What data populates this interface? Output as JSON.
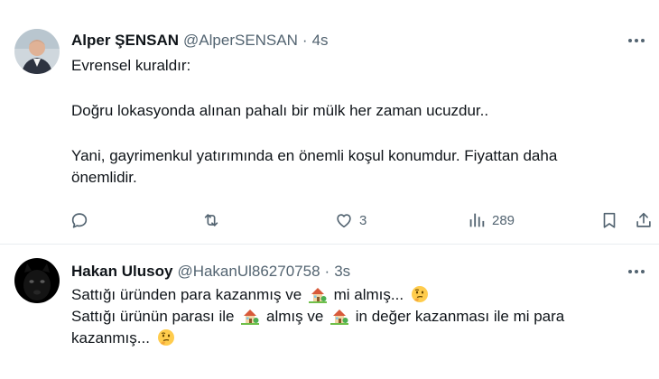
{
  "tweets": [
    {
      "name": "Alper ŞENSAN",
      "handle": "@AlperSENSAN",
      "separator": "·",
      "time": "4s",
      "more_icon": "more-horizontal-icon",
      "lines": [
        "Evrensel kuraldır:",
        "Doğru lokasyonda alınan pahalı bir mülk her zaman ucuzdur..",
        "Yani, gayrimenkul yatırımında en önemli koşul konumdur. Fiyattan daha",
        "önemlidir."
      ],
      "actions": {
        "reply_icon": "reply-icon",
        "retweet_icon": "retweet-icon",
        "like_icon": "heart-icon",
        "like_count": "3",
        "views_icon": "analytics-icon",
        "views_count": "289",
        "bookmark_icon": "bookmark-icon",
        "share_icon": "share-icon"
      }
    },
    {
      "name": "Hakan Ulusoy",
      "handle": "@HakanUl86270758",
      "separator": "·",
      "time": "3s",
      "more_icon": "more-horizontal-icon",
      "line1_a": "Sattığı üründen para kazanmış ve",
      "line1_b": "mi almış...",
      "line2_a": "Sattığı ürünün parası ile",
      "line2_b": "almış ve",
      "line2_c": "in değer kazanması ile mi para",
      "line3_a": "kazanmış...",
      "emojis": [
        "house-with-garden-emoji",
        "thinking-face-emoji"
      ]
    }
  ],
  "colors": {
    "text": "#0f1419",
    "secondary": "#536471",
    "divider": "#e9edf0"
  }
}
